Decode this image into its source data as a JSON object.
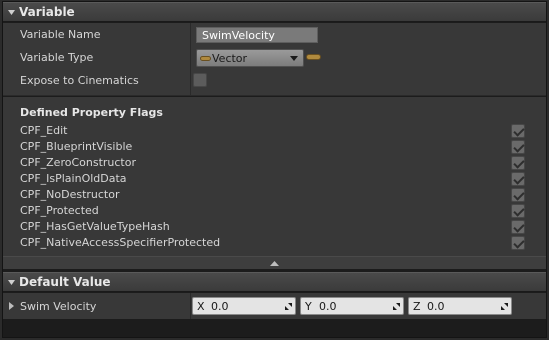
{
  "variable_section": {
    "title": "Variable",
    "rows": {
      "name_label": "Variable Name",
      "name_value": "SwimVelocity",
      "type_label": "Variable Type",
      "type_value": "Vector",
      "expose_label": "Expose to Cinematics",
      "expose_checked": false
    }
  },
  "flags": {
    "title": "Defined Property Flags",
    "items": [
      {
        "label": "CPF_Edit",
        "checked": true
      },
      {
        "label": "CPF_BlueprintVisible",
        "checked": true
      },
      {
        "label": "CPF_ZeroConstructor",
        "checked": true
      },
      {
        "label": "CPF_IsPlainOldData",
        "checked": true
      },
      {
        "label": "CPF_NoDestructor",
        "checked": true
      },
      {
        "label": "CPF_Protected",
        "checked": true
      },
      {
        "label": "CPF_HasGetValueTypeHash",
        "checked": true
      },
      {
        "label": "CPF_NativeAccessSpecifierProtected",
        "checked": true
      }
    ]
  },
  "default_section": {
    "title": "Default Value",
    "property_label": "Swim Velocity",
    "vector": {
      "x_axis": "X",
      "x_value": "0.0",
      "y_axis": "Y",
      "y_value": "0.0",
      "z_axis": "Z",
      "z_value": "0.0"
    }
  },
  "colors": {
    "header_bg": "#444444",
    "panel_bg": "#383838",
    "vector_pin": "#b08a3e"
  }
}
